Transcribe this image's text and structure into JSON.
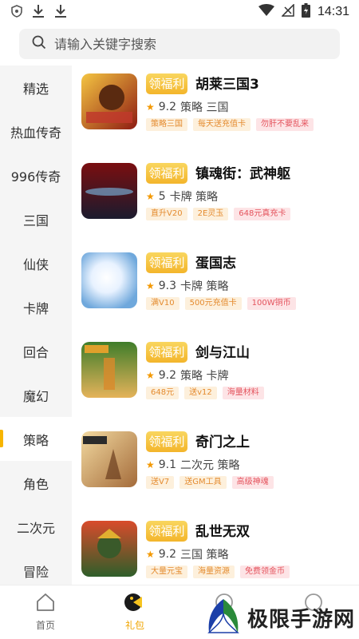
{
  "status_bar": {
    "time": "14:31"
  },
  "search": {
    "placeholder": "请输入关键字搜索"
  },
  "sidebar": {
    "items": [
      {
        "label": "精选"
      },
      {
        "label": "热血传奇"
      },
      {
        "label": "996传奇"
      },
      {
        "label": "三国"
      },
      {
        "label": "仙侠"
      },
      {
        "label": "卡牌"
      },
      {
        "label": "回合"
      },
      {
        "label": "魔幻"
      },
      {
        "label": "策略",
        "active": true
      },
      {
        "label": "角色"
      },
      {
        "label": "二次元"
      },
      {
        "label": "冒险"
      }
    ]
  },
  "games": [
    {
      "badge": "领福利",
      "name": "胡莱三国3",
      "rating": "9.2",
      "genres": "策略 三国",
      "tags": [
        "策略三国",
        "每天送充值卡",
        "勿肝不要乱来"
      ],
      "thumb_colors": [
        "#c0392b",
        "#f4c542"
      ]
    },
    {
      "badge": "领福利",
      "name": "镇魂街：武神躯",
      "rating": "5",
      "genres": "卡牌 策略",
      "tags": [
        "直升V20",
        "2E灵玉",
        "648元真充卡"
      ],
      "thumb_colors": [
        "#7a0e10",
        "#1b1b2e"
      ]
    },
    {
      "badge": "领福利",
      "name": "蛋国志",
      "rating": "9.3",
      "genres": "卡牌 策略",
      "tags": [
        "满V10",
        "500元充值卡",
        "100W铜币"
      ],
      "thumb_colors": [
        "#ffffff",
        "#6fa8dc"
      ]
    },
    {
      "badge": "领福利",
      "name": "剑与江山",
      "rating": "9.2",
      "genres": "策略 卡牌",
      "tags": [
        "648元",
        "送v12",
        "海量材料"
      ],
      "thumb_colors": [
        "#3f7d2a",
        "#e5b35a"
      ]
    },
    {
      "badge": "领福利",
      "name": "奇门之上",
      "rating": "9.1",
      "genres": "二次元 策略",
      "tags": [
        "送V7",
        "送GM工具",
        "高级神魂"
      ],
      "thumb_colors": [
        "#a46b3a",
        "#f2d9a0"
      ]
    },
    {
      "badge": "领福利",
      "name": "乱世无双",
      "rating": "9.2",
      "genres": "三国 策略",
      "tags": [
        "大量元宝",
        "海量资源",
        "免费领金币"
      ],
      "thumb_colors": [
        "#2e5e2a",
        "#d94b2b"
      ]
    }
  ],
  "bottom_nav": {
    "tabs": [
      {
        "label": "首页",
        "icon": "home-icon"
      },
      {
        "label": "礼包",
        "icon": "gift-icon",
        "active": true
      }
    ]
  },
  "watermark": {
    "text": "极限手游网"
  },
  "colors": {
    "accent": "#f7b500",
    "badge": "#f3b52b",
    "star": "#f39800"
  }
}
